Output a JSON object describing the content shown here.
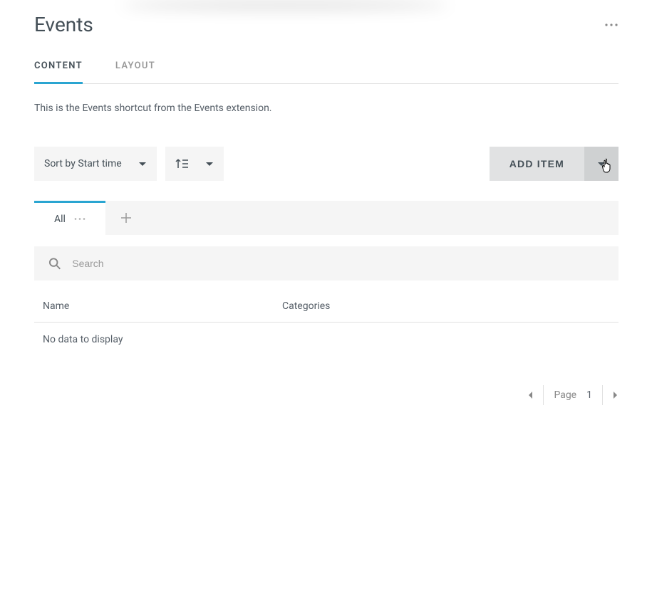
{
  "header": {
    "title": "Events"
  },
  "tabs": {
    "content": "CONTENT",
    "layout": "LAYOUT"
  },
  "description": "This is the Events shortcut from the Events extension.",
  "toolbar": {
    "sort_label": "Sort by Start time",
    "add_item_label": "ADD ITEM"
  },
  "subtabs": {
    "all_label": "All"
  },
  "search": {
    "placeholder": "Search"
  },
  "table": {
    "columns": {
      "name": "Name",
      "categories": "Categories"
    },
    "empty_message": "No data to display"
  },
  "pagination": {
    "label": "Page",
    "current": "1"
  }
}
